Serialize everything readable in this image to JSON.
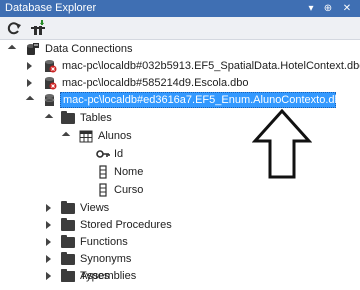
{
  "window": {
    "title": "Database Explorer",
    "pin_glyph": "⊕",
    "close_glyph": "✕",
    "dropdown_glyph": "▾"
  },
  "toolbar": {
    "refresh_icon": "refresh-icon",
    "connect_icon": "connect-database-icon"
  },
  "tree": {
    "root": {
      "label": "Data Connections",
      "icon": "data-connections-icon"
    },
    "connections": [
      {
        "label": "mac-pc\\localdb#032b5913.EF5_SpatialData.HotelContext.dbo",
        "status": "error"
      },
      {
        "label": "mac-pc\\localdb#585214d9.Escola.dbo",
        "status": "error"
      },
      {
        "label": "mac-pc\\localdb#ed3616a7.EF5_Enum.AlunoContexto.dbo",
        "status": "connected"
      }
    ],
    "tables_folder": "Tables",
    "table": {
      "label": "Alunos"
    },
    "columns": [
      {
        "label": "Id",
        "icon": "key-icon"
      },
      {
        "label": "Nome",
        "icon": "column-icon"
      },
      {
        "label": "Curso",
        "icon": "column-icon"
      }
    ],
    "other_folders": [
      "Views",
      "Stored Procedures",
      "Functions",
      "Synonyms",
      "Types",
      "Assemblies"
    ]
  },
  "colors": {
    "titlebar": "#3f6fb3",
    "selection": "#3399ff",
    "error_badge": "#cc2222"
  }
}
